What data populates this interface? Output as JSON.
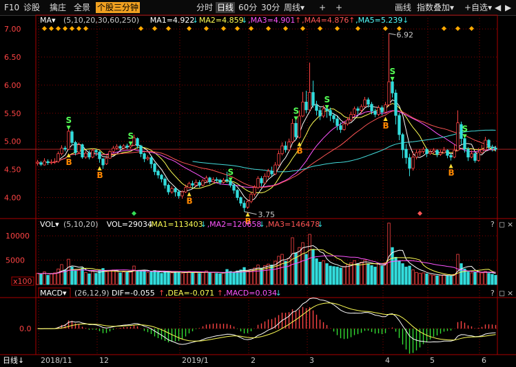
{
  "toolbar": {
    "left": [
      {
        "label": "F10",
        "name": "f10-button"
      },
      {
        "label": "诊股",
        "name": "diagnose-button"
      },
      {
        "label": "擒庄",
        "name": "capture-button"
      },
      {
        "label": "全景",
        "name": "panorama-button"
      },
      {
        "label": "个股三分钟",
        "name": "three-minute-button"
      }
    ],
    "periods": [
      {
        "label": "分时",
        "name": "period-intraday"
      },
      {
        "label": "日线",
        "name": "period-daily"
      },
      {
        "label": "60分",
        "name": "period-60min"
      },
      {
        "label": "30分",
        "name": "period-30min"
      },
      {
        "label": "周线",
        "name": "period-weekly"
      }
    ],
    "plus_icons": [
      "+",
      "+"
    ],
    "right": [
      {
        "label": "画线",
        "name": "draw-line-button"
      },
      {
        "label": "指数叠加",
        "name": "index-overlay-button"
      },
      {
        "label": "+自选",
        "name": "add-watchlist-button"
      }
    ],
    "dropdown_glyph": "▾",
    "nav_arrows": [
      "◀",
      "▶"
    ]
  },
  "main_panel": {
    "indicator": "MA",
    "params": "(5,10,20,30,60,250)",
    "readouts": [
      {
        "text": "MA1=4.922",
        "arrow": "↓",
        "color": "#ffffff"
      },
      {
        "text": "MA2=4.859",
        "arrow": "↓",
        "color": "#ffff55"
      },
      {
        "text": ",MA3=4.901",
        "arrow": "↑",
        "color": "#ff55ff"
      },
      {
        "text": ",MA4=4.876",
        "arrow": "↑",
        "color": "#ff5555"
      },
      {
        "text": ",MA5=5.239",
        "arrow": "↓",
        "color": "#55ffff"
      }
    ],
    "price_labels": [
      "7.00",
      "6.50",
      "6.00",
      "5.50",
      "5.00",
      "4.50",
      "4.00"
    ],
    "high_marker": "6.92",
    "low_marker": "3.75",
    "buy_label": "B",
    "sell_label": "S"
  },
  "volume_panel": {
    "indicator": "VOL",
    "params": "(5,10,20)",
    "readouts": [
      {
        "text": "VOL=29034",
        "color": "#ffffff",
        "arrow": ""
      },
      {
        "text": ",MA1=113403",
        "arrow": "↓",
        "color": "#ffff55"
      },
      {
        "text": ",MA2=120658",
        "arrow": "↓",
        "color": "#ff55ff"
      },
      {
        "text": ",MA3=146478",
        "arrow": "↓",
        "color": "#ff5555"
      }
    ],
    "axis_labels": [
      "10000",
      "5000"
    ],
    "unit": "x100"
  },
  "macd_panel": {
    "indicator": "MACD",
    "params": "(26,12,9)",
    "readouts": [
      {
        "text": "DIF=-0.055",
        "arrow": "↑",
        "color": "#ffffff"
      },
      {
        "text": ",DEA=-0.071",
        "arrow": "↑",
        "color": "#ffff55"
      },
      {
        "text": ",MACD=0.034",
        "arrow": "↓",
        "color": "#ff55ff"
      }
    ],
    "axis_labels": [
      "0.0"
    ]
  },
  "panel_icons": [
    "?",
    "◻",
    "×"
  ],
  "date_axis": {
    "period_label": "日线",
    "ticks": [
      "2018/11",
      "12",
      "2019/1",
      "2",
      "3",
      "4",
      "5",
      "6"
    ]
  },
  "colors": {
    "up": "#ff4444",
    "down": "#33dddd",
    "grid": "#8b0000",
    "axis": "#aa0000"
  },
  "chart_data": {
    "type": "candlestick",
    "xlabel": "",
    "ylabel": "",
    "ylim": [
      3.7,
      7.05
    ],
    "x": [
      "2018/11",
      "12",
      "2019/1",
      "2",
      "3",
      "4",
      "5",
      "6"
    ],
    "candles": [
      [
        4.61,
        4.63,
        4.57,
        4.67
      ],
      [
        4.62,
        4.59,
        4.56,
        4.65
      ],
      [
        4.58,
        4.65,
        4.57,
        4.7
      ],
      [
        4.64,
        4.62,
        4.58,
        4.68
      ],
      [
        4.62,
        4.63,
        4.59,
        4.68
      ],
      [
        4.63,
        4.64,
        4.6,
        4.7
      ],
      [
        4.64,
        4.78,
        4.62,
        4.82
      ],
      [
        4.78,
        4.88,
        4.75,
        4.93
      ],
      [
        4.88,
        4.86,
        4.82,
        4.92
      ],
      [
        4.86,
        5.18,
        4.85,
        5.25
      ],
      [
        5.17,
        4.98,
        4.93,
        5.2
      ],
      [
        4.98,
        4.8,
        4.75,
        5.01
      ],
      [
        4.81,
        4.94,
        4.78,
        4.98
      ],
      [
        4.94,
        4.72,
        4.69,
        4.96
      ],
      [
        4.72,
        4.79,
        4.69,
        4.83
      ],
      [
        4.79,
        4.72,
        4.68,
        4.84
      ],
      [
        4.72,
        4.84,
        4.7,
        4.87
      ],
      [
        4.84,
        4.81,
        4.74,
        4.86
      ],
      [
        4.81,
        4.69,
        4.62,
        4.83
      ],
      [
        4.69,
        4.58,
        4.51,
        4.7
      ],
      [
        4.6,
        4.7,
        4.58,
        4.74
      ],
      [
        4.7,
        4.82,
        4.69,
        4.84
      ],
      [
        4.82,
        4.88,
        4.8,
        4.92
      ],
      [
        4.88,
        4.91,
        4.85,
        4.95
      ],
      [
        4.91,
        4.88,
        4.84,
        4.94
      ],
      [
        4.88,
        4.92,
        4.86,
        4.95
      ],
      [
        4.92,
        4.9,
        4.86,
        4.96
      ],
      [
        4.9,
        4.93,
        4.87,
        4.97
      ],
      [
        4.93,
        5.06,
        4.92,
        5.12
      ],
      [
        5.05,
        4.92,
        4.87,
        5.07
      ],
      [
        4.92,
        4.78,
        4.72,
        4.94
      ],
      [
        4.78,
        4.69,
        4.63,
        4.8
      ],
      [
        4.69,
        4.71,
        4.66,
        4.75
      ],
      [
        4.71,
        4.6,
        4.52,
        4.73
      ],
      [
        4.6,
        4.46,
        4.4,
        4.62
      ],
      [
        4.47,
        4.4,
        4.34,
        4.5
      ],
      [
        4.4,
        4.33,
        4.27,
        4.42
      ],
      [
        4.33,
        4.22,
        4.16,
        4.36
      ],
      [
        4.22,
        4.1,
        4.05,
        4.25
      ],
      [
        4.1,
        4.16,
        4.07,
        4.2
      ],
      [
        4.16,
        4.1,
        4.02,
        4.18
      ],
      [
        4.1,
        4.03,
        3.98,
        4.14
      ],
      [
        4.03,
        4.1,
        3.98,
        4.13
      ],
      [
        4.1,
        4.18,
        4.08,
        4.23
      ],
      [
        4.18,
        4.25,
        4.16,
        4.28
      ],
      [
        4.25,
        4.22,
        4.17,
        4.3
      ],
      [
        4.22,
        4.27,
        4.19,
        4.32
      ],
      [
        4.27,
        4.22,
        4.18,
        4.31
      ],
      [
        4.22,
        4.3,
        4.2,
        4.33
      ],
      [
        4.3,
        4.35,
        4.26,
        4.39
      ],
      [
        4.35,
        4.28,
        4.24,
        4.37
      ],
      [
        4.28,
        4.32,
        4.27,
        4.36
      ],
      [
        4.32,
        4.31,
        4.28,
        4.36
      ],
      [
        4.31,
        4.27,
        4.23,
        4.33
      ],
      [
        4.27,
        4.31,
        4.25,
        4.35
      ],
      [
        4.32,
        4.3,
        4.26,
        4.46
      ],
      [
        4.3,
        4.22,
        4.18,
        4.33
      ],
      [
        4.22,
        4.13,
        4.07,
        4.25
      ],
      [
        4.13,
        4.0,
        3.95,
        4.15
      ],
      [
        4.0,
        3.9,
        3.85,
        4.02
      ],
      [
        3.9,
        3.82,
        3.75,
        3.95
      ],
      [
        3.83,
        3.93,
        3.8,
        3.97
      ],
      [
        3.93,
        4.06,
        3.9,
        4.1
      ],
      [
        4.06,
        4.18,
        4.02,
        4.22
      ],
      [
        4.18,
        4.34,
        4.15,
        4.38
      ],
      [
        4.34,
        4.26,
        4.2,
        4.38
      ],
      [
        4.26,
        4.38,
        4.24,
        4.43
      ],
      [
        4.38,
        4.47,
        4.35,
        4.51
      ],
      [
        4.47,
        4.42,
        4.38,
        4.55
      ],
      [
        4.42,
        4.58,
        4.4,
        4.63
      ],
      [
        4.58,
        4.78,
        4.56,
        4.84
      ],
      [
        4.78,
        4.92,
        4.75,
        4.98
      ],
      [
        4.92,
        4.85,
        4.8,
        5.0
      ],
      [
        4.85,
        4.99,
        4.82,
        5.05
      ],
      [
        4.99,
        5.32,
        4.97,
        5.4
      ],
      [
        5.32,
        5.08,
        5.02,
        5.42
      ],
      [
        5.07,
        5.45,
        5.05,
        5.55
      ],
      [
        5.45,
        5.7,
        5.43,
        5.88
      ],
      [
        5.7,
        5.56,
        5.5,
        5.9
      ],
      [
        5.56,
        5.87,
        5.53,
        6.4
      ],
      [
        5.87,
        5.64,
        5.6,
        6.08
      ],
      [
        5.64,
        5.55,
        5.46,
        5.72
      ],
      [
        5.55,
        5.45,
        5.38,
        5.6
      ],
      [
        5.45,
        5.58,
        5.42,
        5.64
      ],
      [
        5.58,
        5.55,
        5.42,
        5.62
      ],
      [
        5.55,
        5.46,
        5.36,
        5.6
      ],
      [
        5.46,
        5.4,
        5.33,
        5.5
      ],
      [
        5.4,
        5.28,
        5.2,
        5.45
      ],
      [
        5.28,
        5.21,
        5.15,
        5.34
      ],
      [
        5.21,
        5.31,
        5.19,
        5.36
      ],
      [
        5.31,
        5.38,
        5.28,
        5.43
      ],
      [
        5.38,
        5.48,
        5.35,
        5.53
      ],
      [
        5.48,
        5.58,
        5.45,
        5.62
      ],
      [
        5.58,
        5.55,
        5.48,
        5.62
      ],
      [
        5.55,
        5.62,
        5.5,
        5.66
      ],
      [
        5.62,
        5.74,
        5.6,
        5.79
      ],
      [
        5.74,
        5.66,
        5.6,
        5.78
      ],
      [
        5.66,
        5.54,
        5.48,
        5.7
      ],
      [
        5.54,
        5.48,
        5.43,
        5.58
      ],
      [
        5.48,
        5.6,
        5.45,
        5.64
      ],
      [
        5.6,
        5.52,
        5.46,
        5.64
      ],
      [
        5.52,
        5.65,
        5.5,
        5.7
      ],
      [
        5.65,
        6.06,
        5.62,
        6.92
      ],
      [
        6.06,
        5.86,
        5.78,
        6.12
      ],
      [
        5.86,
        5.46,
        5.3,
        5.92
      ],
      [
        5.46,
        5.12,
        5.02,
        5.5
      ],
      [
        5.12,
        4.85,
        4.7,
        5.15
      ],
      [
        4.86,
        4.71,
        4.6,
        4.95
      ],
      [
        4.71,
        4.52,
        4.38,
        4.78
      ],
      [
        4.52,
        4.72,
        4.48,
        4.82
      ],
      [
        4.72,
        4.8,
        4.68,
        4.85
      ],
      [
        4.8,
        4.82,
        4.74,
        4.86
      ],
      [
        4.82,
        4.86,
        4.78,
        4.9
      ],
      [
        4.86,
        4.78,
        4.72,
        4.88
      ],
      [
        4.78,
        4.81,
        4.76,
        4.85
      ],
      [
        4.81,
        4.84,
        4.78,
        4.88
      ],
      [
        4.84,
        4.77,
        4.72,
        4.86
      ],
      [
        4.77,
        4.8,
        4.74,
        4.85
      ],
      [
        4.8,
        4.84,
        4.78,
        4.9
      ],
      [
        4.84,
        4.75,
        4.7,
        4.86
      ],
      [
        4.75,
        4.72,
        4.66,
        4.78
      ],
      [
        4.72,
        4.84,
        4.7,
        4.95
      ],
      [
        4.84,
        5.33,
        4.82,
        5.55
      ],
      [
        5.3,
        5.05,
        4.95,
        5.35
      ],
      [
        5.05,
        4.86,
        4.8,
        5.1
      ],
      [
        4.86,
        4.72,
        4.65,
        4.9
      ],
      [
        4.72,
        4.78,
        4.7,
        4.84
      ],
      [
        4.78,
        4.66,
        4.62,
        4.8
      ],
      [
        4.66,
        4.8,
        4.64,
        4.88
      ],
      [
        4.8,
        4.85,
        4.78,
        4.94
      ],
      [
        4.85,
        5.02,
        4.83,
        5.08
      ],
      [
        5.02,
        4.9,
        4.85,
        5.04
      ],
      [
        4.9,
        4.88,
        4.82,
        4.94
      ],
      [
        4.88,
        4.86,
        4.82,
        4.92
      ]
    ],
    "volume": [
      2300,
      2100,
      2600,
      1900,
      2200,
      2400,
      3200,
      4100,
      3000,
      5200,
      3600,
      2800,
      3100,
      3400,
      2500,
      2200,
      2700,
      2300,
      2900,
      3300,
      2600,
      2800,
      3000,
      2700,
      2400,
      2600,
      2500,
      2700,
      3800,
      2900,
      2800,
      2700,
      2500,
      2600,
      2900,
      2500,
      2300,
      2600,
      2700,
      2400,
      2500,
      2600,
      2300,
      2500,
      2700,
      2400,
      2500,
      2300,
      2600,
      2800,
      2400,
      2500,
      2300,
      2200,
      2400,
      3100,
      2700,
      2500,
      2800,
      3000,
      3500,
      2900,
      3100,
      3400,
      4000,
      3300,
      3900,
      4200,
      4000,
      4800,
      5800,
      6200,
      4800,
      5400,
      9600,
      6500,
      7600,
      8600,
      6200,
      10300,
      7200,
      5300,
      4600,
      4900,
      4300,
      3800,
      3700,
      3600,
      3400,
      3700,
      4100,
      4500,
      4900,
      4300,
      4600,
      5000,
      4300,
      3900,
      3600,
      4300,
      3800,
      4500,
      12600,
      7600,
      5600,
      4900,
      4300,
      3600,
      3800,
      3000,
      2500,
      2300,
      2400,
      2200,
      2000,
      1900,
      1800,
      1900,
      2000,
      1800,
      1700,
      2100,
      6200,
      4300,
      3200,
      2600,
      2400,
      2500,
      2600,
      2400,
      2700,
      2300,
      2100,
      1900
    ],
    "volume_ylim": [
      0,
      11000
    ],
    "macd_ylim": [
      -0.28,
      0.34
    ]
  }
}
